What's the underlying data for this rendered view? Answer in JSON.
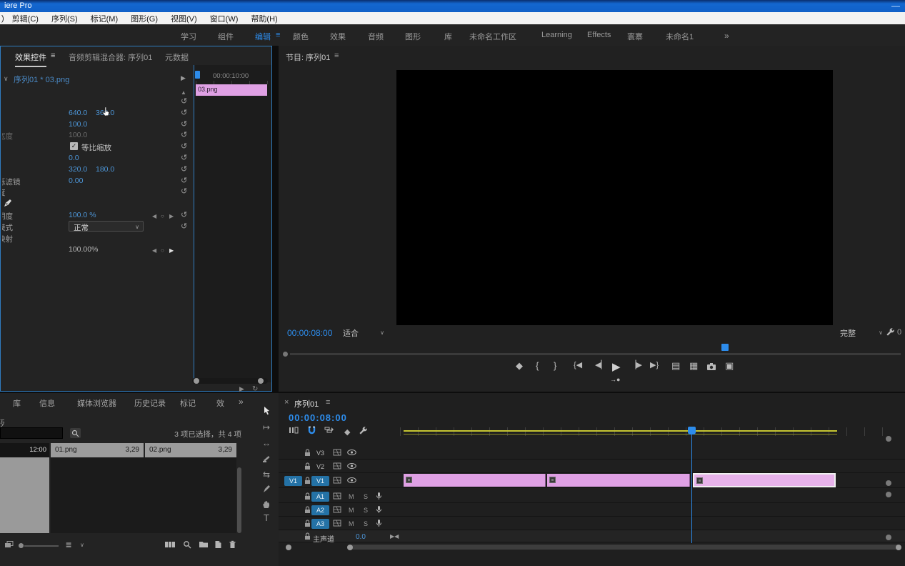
{
  "colors": {
    "accent": "#2d8ceb",
    "value_blue": "#4d96d8",
    "clip_pink": "#dfa0e4",
    "workarea_yellow": "#c6c632",
    "titlebar_blue": "#1060c8"
  },
  "titlebar": {
    "title": "iere Pro",
    "minimize": "—"
  },
  "menubar": {
    "fragment": ")",
    "items": [
      "剪辑(C)",
      "序列(S)",
      "标记(M)",
      "图形(G)",
      "视图(V)",
      "窗口(W)",
      "帮助(H)"
    ]
  },
  "workspace": {
    "tabs": [
      {
        "label": "学习"
      },
      {
        "label": "组件"
      },
      {
        "label": "编辑"
      },
      {
        "label": "颜色"
      },
      {
        "label": "效果"
      },
      {
        "label": "音频"
      },
      {
        "label": "图形"
      },
      {
        "label": "库"
      },
      {
        "label": "未命名工作区"
      },
      {
        "label": "Learning"
      },
      {
        "label": "Effects"
      },
      {
        "label": "寰寨"
      },
      {
        "label": "未命名1"
      }
    ],
    "active_menu_glyph": "≡",
    "overflow": "»"
  },
  "effect_controls": {
    "tabs": [
      {
        "label": "效果控件",
        "menu": "≡"
      },
      {
        "label": "音频剪辑混合器: 序列01"
      },
      {
        "label": "元数据"
      }
    ],
    "clip_chevron": "∨",
    "clip_title": "序列01 * 03.png",
    "expand_arrow": "▶",
    "scroll_up": "▲",
    "reset_glyph": "↺",
    "checkbox_glyph": "✓",
    "nav": {
      "prev": "◀",
      "dot": "○",
      "next": "▶"
    },
    "timeline": {
      "timecode": "00:00:10:00",
      "clip_label": "03.png"
    },
    "rows": [
      {},
      {
        "v1": "640.0",
        "v2": "360.0"
      },
      {
        "v1": "100.0"
      },
      {
        "label": "宽度",
        "v1": "100.0"
      },
      {
        "label": "等比缩放"
      },
      {
        "v1": "0.0"
      },
      {
        "v1": "320.0",
        "v2": "180.0"
      },
      {
        "label": "烁滤镜",
        "v1": "0.00"
      },
      {
        "label": "度"
      },
      {},
      {
        "label": "明度",
        "v1": "100.0 %"
      },
      {
        "label": "模式",
        "dropdown": "正常",
        "chevron": "∨"
      },
      {
        "label": "映射"
      },
      {
        "v1": "100.00%"
      }
    ],
    "bottom_icons": {
      "play_audio": "▶",
      "toggle": "↻"
    }
  },
  "program": {
    "title": "节目: 序列01",
    "menu": "≡",
    "timecode": "00:00:08:00",
    "zoom_select": "适合",
    "zoom_chevron": "∨",
    "quality_select": "完整",
    "quality_chevron": "∨",
    "edge_fragment": "0",
    "transport": {
      "add_marker": "◆",
      "mark_in": "{",
      "mark_out": "}",
      "goto_in": "{◀",
      "step_back": "◀▏",
      "play": "▶",
      "step_fwd": "▕▶",
      "goto_out": "▶}",
      "lift": "▤",
      "extract": "▦",
      "compare": "▣",
      "extra": "→●"
    }
  },
  "project": {
    "tabs": [
      "库",
      "信息",
      "媒体浏览器",
      "历史记录",
      "标记",
      "效"
    ],
    "overflow": "»",
    "edge_fragment": "列",
    "status": "3 项已选择，共 4 项",
    "thumb_time": "12:00",
    "clips": [
      {
        "name": "01.png",
        "duration": "3,29"
      },
      {
        "name": "02.png",
        "duration": "3,29"
      }
    ],
    "list_glyph": "≡",
    "list_chevron": "∨"
  },
  "tools": {
    "track_glyph": "↦",
    "ripple_glyph": "↔",
    "slip_glyph": "⇆",
    "type_glyph": "T"
  },
  "timeline": {
    "close": "×",
    "tab": "序列01",
    "menu": "≡",
    "timecode": "00:00:08:00",
    "marker_glyph": "◆",
    "video_tracks": [
      {
        "name": "V3"
      },
      {
        "name": "V2"
      },
      {
        "name": "V1"
      }
    ],
    "source_patch": "V1",
    "audio_tracks": [
      {
        "name": "A1"
      },
      {
        "name": "A2"
      },
      {
        "name": "A3"
      }
    ],
    "audio_labels": {
      "mute": "M",
      "solo": "S"
    },
    "master": {
      "label": "主声道",
      "value": "0.0",
      "fit": "▶◀"
    }
  }
}
